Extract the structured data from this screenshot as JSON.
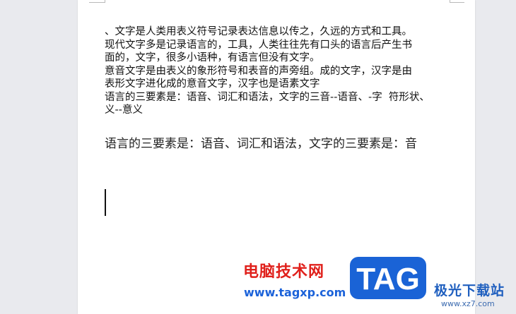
{
  "document": {
    "paragraphs": [
      "、文字是人类用表义符号记录表达信息以传之，久远的方式和工具。",
      "现代文字多是记录语言的，工具，人类往往先有口头的语言后产生书",
      "面的，文字，很多小语种，有语言但没有文字。",
      "意音文字是由表义的象形符号和表音的声旁组。成的文字，汉字是由",
      "表形文字进化成的意音文字，汉字也是语素文字",
      "语言的三要素是：语音、词汇和语法，文字的三音--语音、-字  符形状、",
      "义--意义"
    ],
    "serif_line": "语言的三要素是：语音、词汇和语法，文字的三要素是：音"
  },
  "watermark": {
    "site_name": "电脑技术网",
    "site_url": "www.tagxp.com",
    "logo_text": "TAG",
    "brand_name": "极光下载站",
    "brand_url": "www.xz7.com"
  },
  "colors": {
    "page_bg": "#ffffff",
    "canvas_bg": "#e9eaee",
    "watermark_red": "#e0201b",
    "watermark_blue": "#1b62d9",
    "logo_blue": "#1a63d6"
  }
}
